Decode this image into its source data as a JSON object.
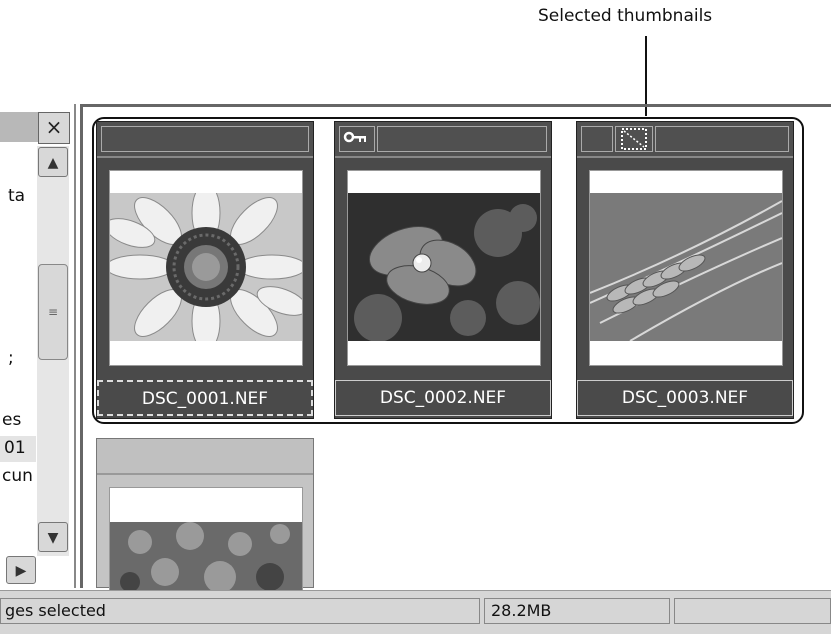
{
  "callout": {
    "label": "Selected thumbnails"
  },
  "left_panel": {
    "close_icon": "×",
    "fragments": [
      "ta",
      ";",
      "es",
      "01",
      "cun"
    ],
    "scroll_up_icon": "▲",
    "scroll_down_icon": "▼",
    "scroll_right_icon": "▶",
    "thumb_grip": "≡"
  },
  "thumbnails": [
    {
      "filename": "DSC_0001.NEF",
      "selected": true,
      "protected": false,
      "marked": false
    },
    {
      "filename": "DSC_0002.NEF",
      "selected": true,
      "protected": true,
      "marked": false
    },
    {
      "filename": "DSC_0003.NEF",
      "selected": true,
      "protected": false,
      "marked": true
    },
    {
      "filename": "",
      "selected": false,
      "protected": false,
      "marked": false
    }
  ],
  "icons": {
    "protect": "key-icon",
    "mark": "dotted-frame-icon"
  },
  "status_bar": {
    "selection_text": "ges selected",
    "size": "28.2MB",
    "extra": ""
  },
  "colors": {
    "thumb_bg": "#4a4a4a",
    "selection_outline": "#111111",
    "unselected_header": "#c0c0c0"
  }
}
